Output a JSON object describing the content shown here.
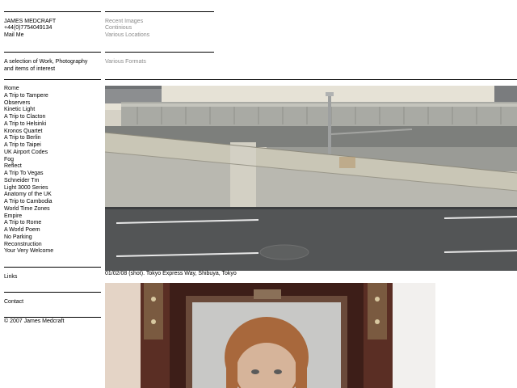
{
  "contact": {
    "name": "JAMES MEDCRAFT",
    "phone": "+44(0)7754049134",
    "mail": "Mail Me"
  },
  "views": [
    "Recent Images",
    "Continious",
    "Various Locations"
  ],
  "tagline": [
    "A selection of Work, Photography",
    "and items of interest"
  ],
  "formats": "Various Formats",
  "nav": [
    "Rome",
    "A Trip to Tampere",
    "Observers",
    "Kinetic Light",
    "A Trip to Clacton",
    "A Trip to Helsinki",
    "Kronos Quartet",
    "A Trip to Berlin",
    "A Trip to Taipei",
    "UK Airport Codes",
    "Fog",
    "Reflect",
    "A Trip To Vegas",
    "Schneider Tm",
    "Light 3000 Series",
    "Anatomy of the UK",
    "A Trip to Cambodia",
    "World Time Zones",
    "Empire",
    "A Trip to Rome",
    "A World Poem",
    "No Parking",
    "Reconstruction",
    "Your Very Welcome"
  ],
  "links": "Links",
  "contact_link": "Contact",
  "copyright": "© 2007 James Medcraft",
  "photo1": {
    "caption": "01/02/08 (shot). Tokyo Express Way, Shibuya, Tokyo"
  }
}
